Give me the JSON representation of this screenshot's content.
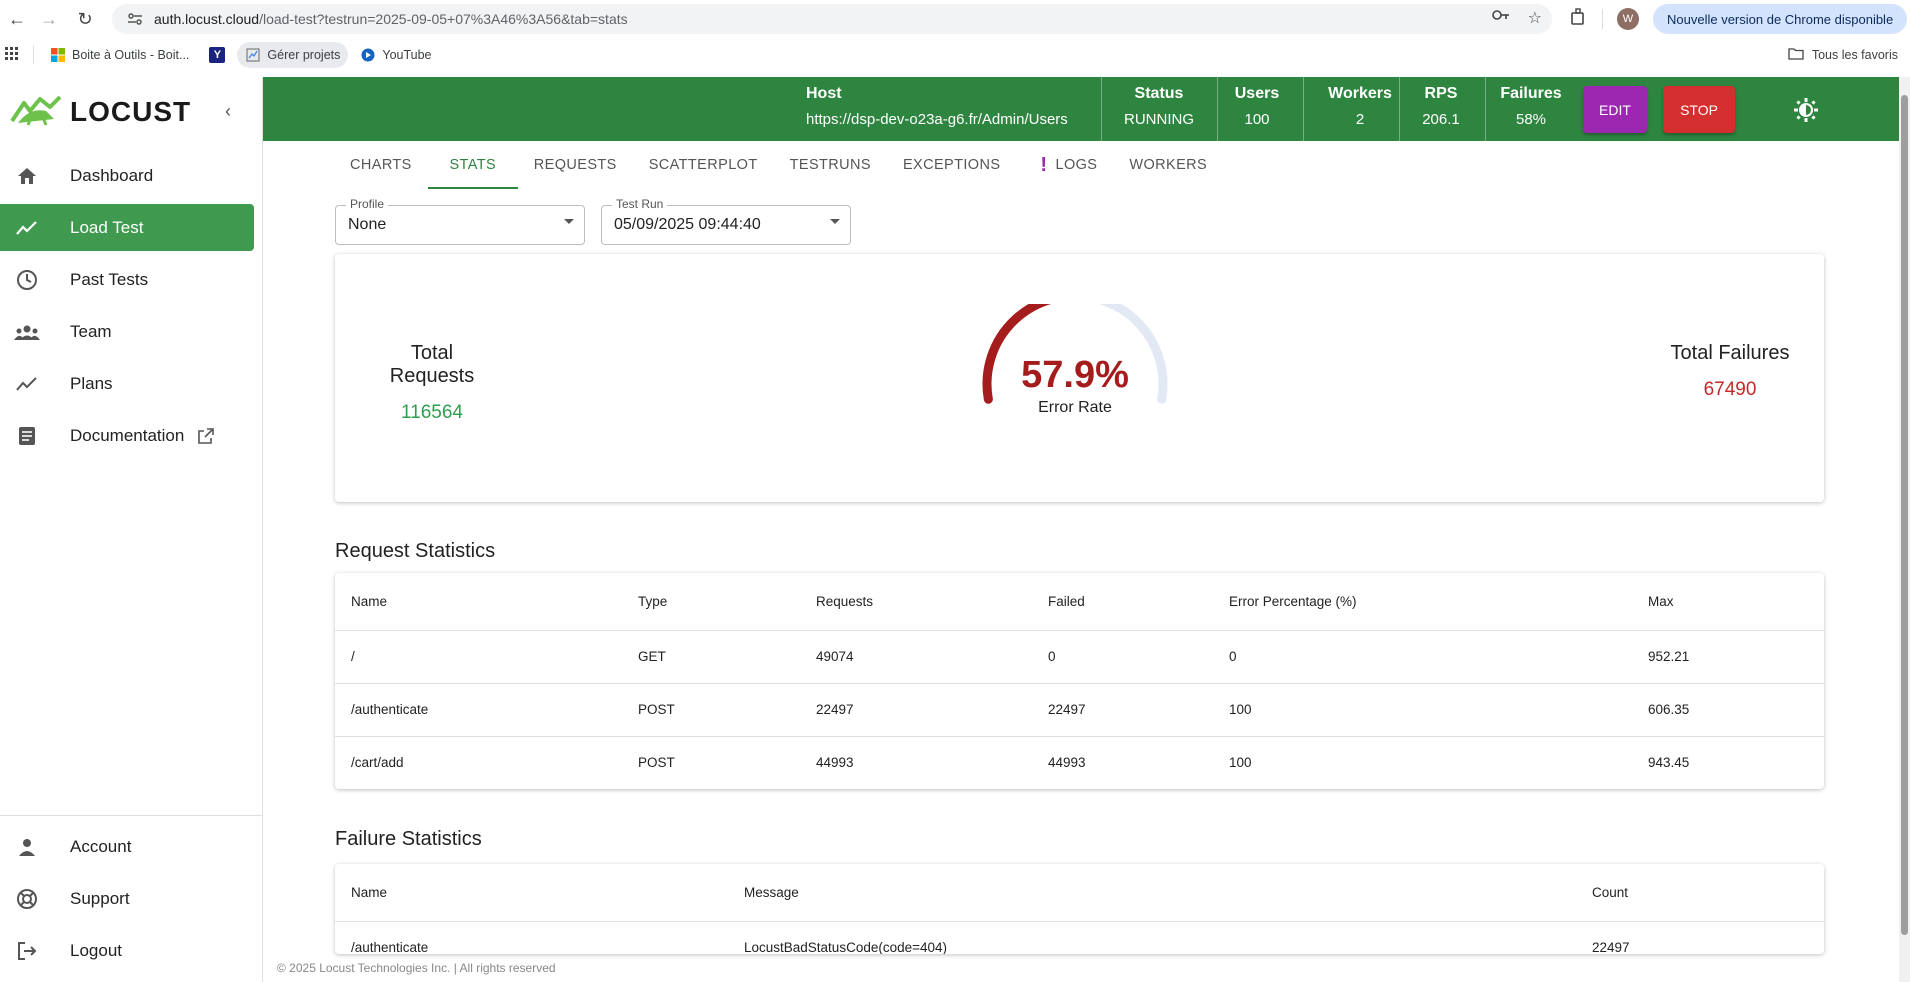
{
  "browser": {
    "url_host": "auth.locust.cloud",
    "url_path": "/load-test?testrun=2025-09-05+07%3A46%3A56&tab=stats",
    "avatar_letter": "W",
    "update_label": "Nouvelle version de Chrome disponible",
    "bookmarks": [
      {
        "label": "Boite à Outils - Boit..."
      },
      {
        "label": ""
      },
      {
        "label": "Gérer projets"
      },
      {
        "label": "YouTube"
      }
    ],
    "all_bookmarks_label": "Tous les favoris"
  },
  "sidebar": {
    "logo_text": "LOCUST",
    "items": [
      {
        "label": "Dashboard",
        "icon": "home-icon"
      },
      {
        "label": "Load Test",
        "icon": "trend-icon",
        "active": true
      },
      {
        "label": "Past Tests",
        "icon": "clock-icon"
      },
      {
        "label": "Team",
        "icon": "team-icon"
      },
      {
        "label": "Plans",
        "icon": "chart-icon"
      },
      {
        "label": "Documentation",
        "icon": "doc-icon"
      }
    ],
    "bottom_items": [
      {
        "label": "Account",
        "icon": "person-icon"
      },
      {
        "label": "Support",
        "icon": "support-icon"
      },
      {
        "label": "Logout",
        "icon": "logout-icon"
      }
    ]
  },
  "header": {
    "host_label": "Host",
    "host_value": "https://dsp-dev-o23a-g6.fr/Admin/Users",
    "status_label": "Status",
    "status_value": "RUNNING",
    "users_label": "Users",
    "users_value": "100",
    "workers_label": "Workers",
    "workers_value": "2",
    "rps_label": "RPS",
    "rps_value": "206.1",
    "failures_label": "Failures",
    "failures_value": "58%",
    "edit_label": "EDIT",
    "stop_label": "STOP",
    "colors": {
      "header_bg": "#2e8540",
      "edit": "#9c27b0",
      "stop": "#d32f2f"
    }
  },
  "tabs": [
    {
      "label": "CHARTS"
    },
    {
      "label": "STATS",
      "active": true
    },
    {
      "label": "REQUESTS"
    },
    {
      "label": "SCATTERPLOT"
    },
    {
      "label": "TESTRUNS"
    },
    {
      "label": "EXCEPTIONS"
    },
    {
      "label": "LOGS",
      "warning": "!"
    },
    {
      "label": "WORKERS"
    }
  ],
  "filters": {
    "profile_label": "Profile",
    "profile_value": "None",
    "testrun_label": "Test Run",
    "testrun_value": "05/09/2025 09:44:40"
  },
  "summary": {
    "total_requests_label": "Total Requests",
    "total_requests_value": "116564",
    "total_failures_label": "Total Failures",
    "total_failures_value": "67490",
    "error_rate_value": "57.9%",
    "error_rate_fraction": 0.579,
    "error_rate_label": "Error Rate",
    "colors": {
      "requests": "#2e9e4f",
      "failures": "#c62828",
      "gauge": "#a51c1c",
      "gauge_track": "#e3e8f5"
    }
  },
  "request_stats": {
    "title": "Request Statistics",
    "columns": [
      "Name",
      "Type",
      "Requests",
      "Failed",
      "Error Percentage (%)",
      "Max"
    ],
    "rows": [
      [
        "/",
        "GET",
        "49074",
        "0",
        "0",
        "952.21"
      ],
      [
        "/authenticate",
        "POST",
        "22497",
        "22497",
        "100",
        "606.35"
      ],
      [
        "/cart/add",
        "POST",
        "44993",
        "44993",
        "100",
        "943.45"
      ]
    ]
  },
  "failure_stats": {
    "title": "Failure Statistics",
    "columns": [
      "Name",
      "Message",
      "Count"
    ],
    "rows": [
      [
        "/authenticate",
        "LocustBadStatusCode(code=404)",
        "22497"
      ]
    ]
  },
  "footer": "© 2025 Locust Technologies Inc. | All rights reserved"
}
